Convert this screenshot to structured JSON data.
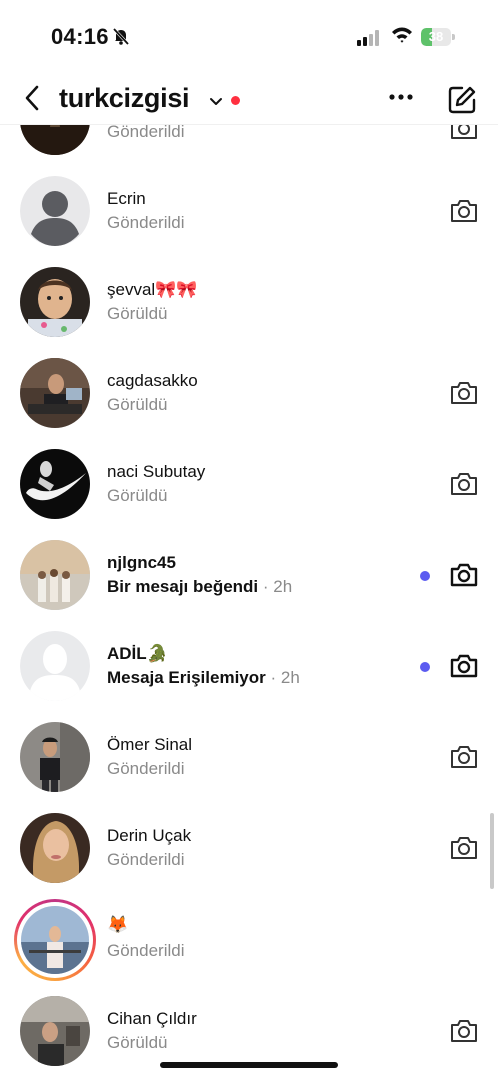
{
  "status_bar": {
    "time": "04:16",
    "battery_level": "38",
    "battery_fraction": 0.38
  },
  "header": {
    "username": "turkcizgisi",
    "icons": [
      "back-arrow-icon",
      "chevron-down-icon",
      "more-icon",
      "compose-icon"
    ],
    "accent_dot_color": "#ff3040"
  },
  "conversations": [
    {
      "name": "",
      "status": "Gönderildi",
      "avatar": "photo-dark-trees",
      "camera": true
    },
    {
      "name": "Ecrin",
      "status": "Gönderildi",
      "avatar": "default-avatar",
      "camera": true
    },
    {
      "name": "şevval🎀🎀",
      "status": "Görüldü",
      "avatar": "photo-child",
      "camera": false
    },
    {
      "name": "cagdasakko",
      "status": "Görüldü",
      "avatar": "photo-desk",
      "camera": true
    },
    {
      "name": "naci Subutay",
      "status": "Görüldü",
      "avatar": "photo-nike-logo",
      "camera": true
    },
    {
      "name": "njlgnc45",
      "status": "Bir mesajı beğendi",
      "time": "· 2h",
      "unread": true,
      "avatar": "photo-group-beach",
      "camera": true
    },
    {
      "name": "ADİL🐊",
      "status": "Mesaja Erişilemiyor",
      "time": "· 2h",
      "unread": true,
      "avatar": "default-avatar-light",
      "camera": true
    },
    {
      "name": "Ömer Sinal",
      "status": "Gönderildi",
      "avatar": "photo-person-street",
      "camera": true
    },
    {
      "name": "Derin Uçak",
      "status": "Gönderildi",
      "avatar": "photo-woman",
      "camera": true
    },
    {
      "name": "🦊",
      "status": "Gönderildi",
      "avatar": "photo-story-ring",
      "camera": false
    },
    {
      "name": "Cihan Çıldır",
      "status": "Görüldü",
      "avatar": "photo-car",
      "camera": true
    }
  ],
  "colors": {
    "unread_dot": "#5b5bf0",
    "secondary_text": "#8a8a8a",
    "story_ring": [
      "#f9a03f",
      "#e1306c",
      "#c13584"
    ]
  }
}
